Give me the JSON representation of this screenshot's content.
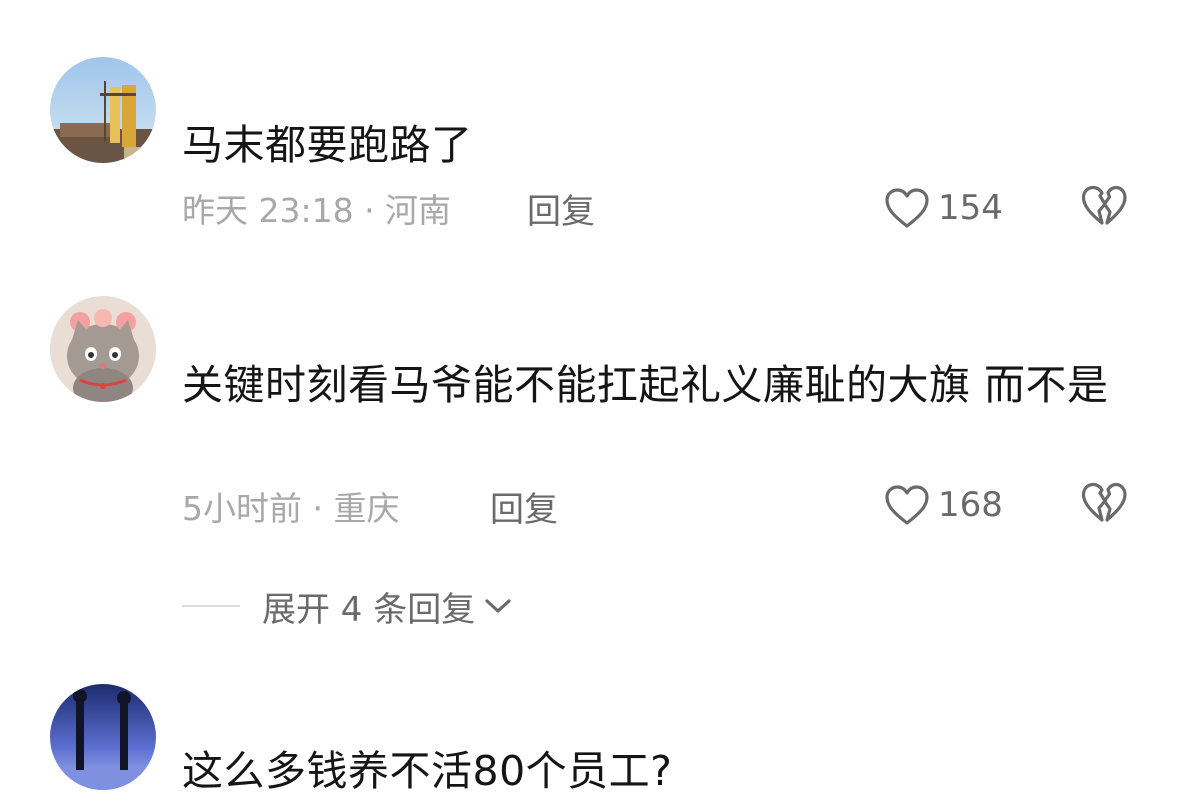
{
  "comments": [
    {
      "text": "马末都要跑路了",
      "meta": "昨天 23:18 · 河南",
      "reply_label": "回复",
      "likes": "154",
      "avatar_icon": "building-sign-avatar"
    },
    {
      "text": "关键时刻看马爷能不能扛起礼义廉耻的大旗 而不是",
      "meta": "5小时前 · 重庆",
      "reply_label": "回复",
      "likes": "168",
      "avatar_icon": "cat-avatar"
    },
    {
      "text": "这么多钱养不活80个员工?",
      "avatar_icon": "silhouette-avatar"
    }
  ],
  "expand_replies": {
    "label": "展开 4 条回复"
  },
  "icons": {
    "like": "heart-outline-icon",
    "dislike": "broken-heart-icon",
    "expand": "chevron-down-icon"
  },
  "colors": {
    "text": "#151515",
    "meta": "#a8a8a8",
    "action": "#6a6a6a"
  }
}
